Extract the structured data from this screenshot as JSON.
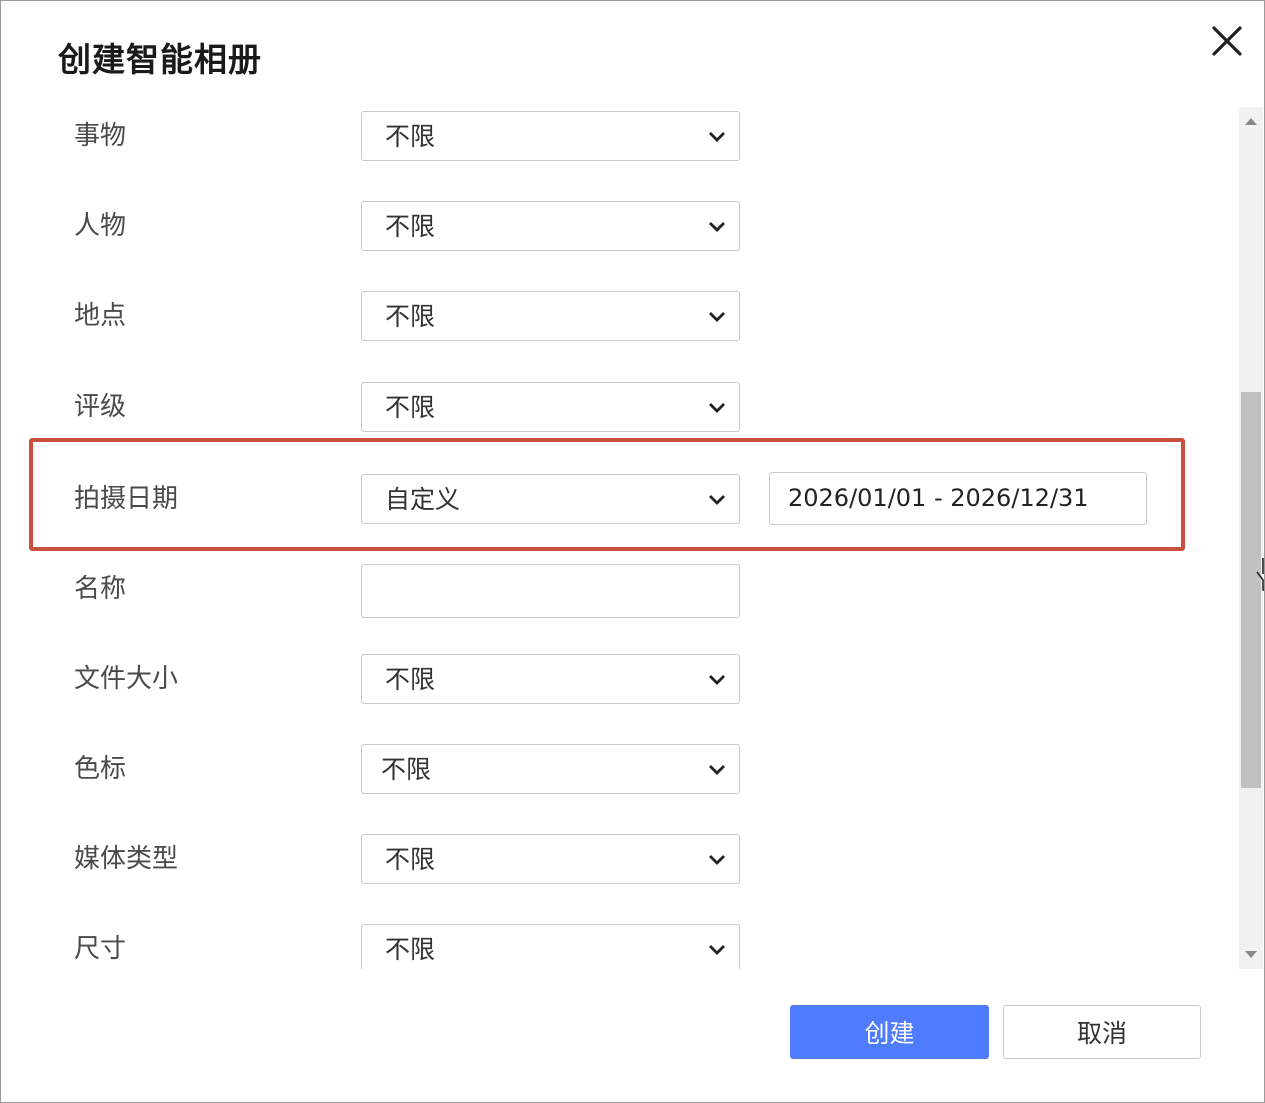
{
  "dialog": {
    "title": "创建智能相册",
    "close_icon": "close-icon"
  },
  "form": {
    "rows": [
      {
        "label": "事物",
        "type": "select",
        "value": "不限"
      },
      {
        "label": "人物",
        "type": "select",
        "value": "不限"
      },
      {
        "label": "地点",
        "type": "select",
        "value": "不限"
      },
      {
        "label": "评级",
        "type": "select",
        "value": "不限"
      },
      {
        "label": "拍摄日期",
        "type": "select",
        "value": "自定义",
        "range": "2026/01/01 - 2026/12/31"
      },
      {
        "label": "名称",
        "type": "text",
        "value": ""
      },
      {
        "label": "文件大小",
        "type": "select",
        "value": "不限"
      },
      {
        "label": "色标",
        "type": "select",
        "value": "不限"
      },
      {
        "label": "媒体类型",
        "type": "select",
        "value": "不限"
      },
      {
        "label": "尺寸",
        "type": "select",
        "value": "不限"
      }
    ]
  },
  "footer": {
    "create_label": "创建",
    "cancel_label": "取消"
  },
  "colors": {
    "primary": "#4f7cff",
    "highlight": "#c9503c"
  }
}
